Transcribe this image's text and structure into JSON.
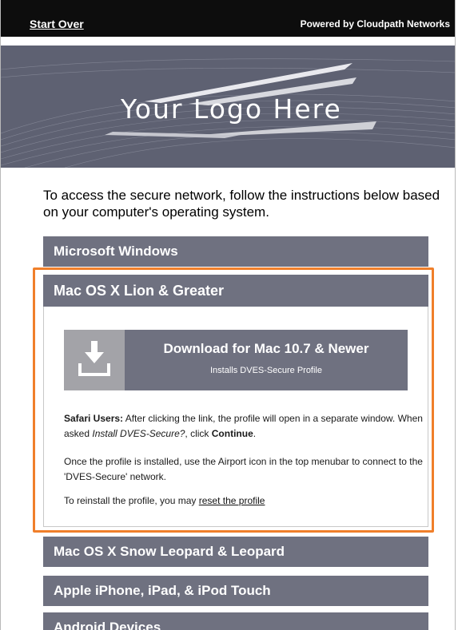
{
  "topbar": {
    "start_over": "Start Over",
    "powered_by": "Powered by Cloudpath Networks"
  },
  "banner": {
    "logo_text": "Your Logo Here"
  },
  "intro": {
    "text": "To access the secure network, follow the instructions below based on your computer's operating system."
  },
  "sections": {
    "windows": "Microsoft Windows",
    "mac_lion": "Mac OS X Lion & Greater",
    "mac_snow": "Mac OS X Snow Leopard & Leopard",
    "apple_ios": "Apple iPhone, iPad, & iPod Touch",
    "android": "Android Devices"
  },
  "download": {
    "title": "Download for Mac 10.7 & Newer",
    "subtitle": "Installs DVES-Secure Profile",
    "icon": "download-icon"
  },
  "instructions": {
    "safari_label": "Safari Users:",
    "safari_text_1": " After clicking the link, the profile will open in a separate window. When asked ",
    "safari_italic": "Install DVES-Secure?",
    "safari_text_2": ", click ",
    "safari_continue": "Continue",
    "safari_end": ".",
    "airport_text": "Once the profile is installed, use the Airport icon in the top menubar to connect to the 'DVES-Secure' network.",
    "reinstall_text": "To reinstall the profile, you may ",
    "reset_link": "reset the profile"
  },
  "colors": {
    "section_bg": "#6f7180",
    "highlight": "#f07f2a",
    "topbar_bg": "#0d0d0d",
    "banner_bg": "#5e6172"
  }
}
